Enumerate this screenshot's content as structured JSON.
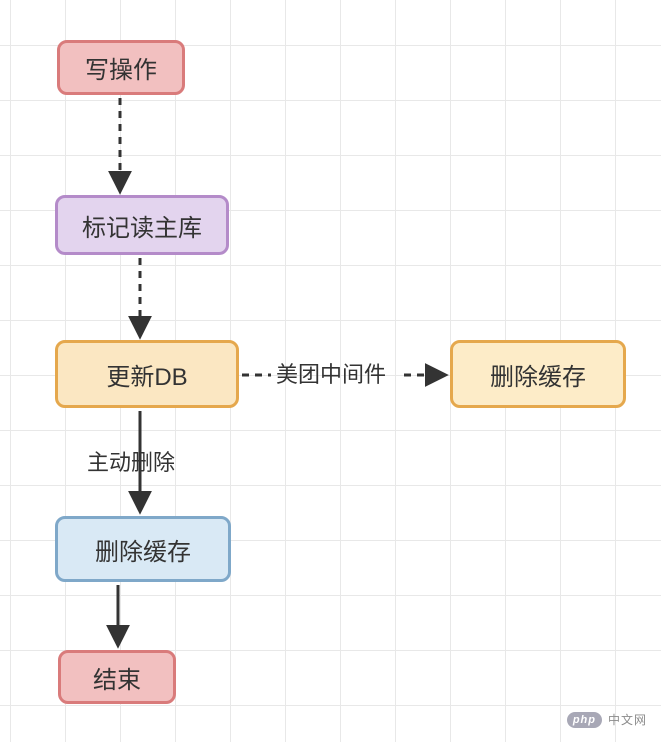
{
  "diagram": {
    "nodes": {
      "write_op": "写操作",
      "mark_master": "标记读主库",
      "update_db": "更新DB",
      "delete_cache_right": "删除缓存",
      "delete_cache_bottom": "删除缓存",
      "end": "结束"
    },
    "edges": {
      "write_to_mark": {
        "from": "write_op",
        "to": "mark_master",
        "style": "dashed",
        "label": ""
      },
      "mark_to_update": {
        "from": "mark_master",
        "to": "update_db",
        "style": "dashed",
        "label": ""
      },
      "update_to_delcache_right": {
        "from": "update_db",
        "to": "delete_cache_right",
        "style": "dashed",
        "label": "美团中间件"
      },
      "update_to_delcache_bottom": {
        "from": "update_db",
        "to": "delete_cache_bottom",
        "style": "solid",
        "label": "主动删除"
      },
      "delcache_to_end": {
        "from": "delete_cache_bottom",
        "to": "end",
        "style": "solid",
        "label": ""
      }
    },
    "colors": {
      "red_fill": "#f2c0c0",
      "red_border": "#d97b7b",
      "purple_fill": "#e3d4ee",
      "purple_border": "#b48bc9",
      "orange_fill": "#fbe7c2",
      "orange_border": "#e5a84d",
      "blue_fill": "#d9e9f5",
      "blue_border": "#7fa8c9"
    }
  },
  "watermark": {
    "logo_text": "php",
    "site_text": "中文网"
  }
}
